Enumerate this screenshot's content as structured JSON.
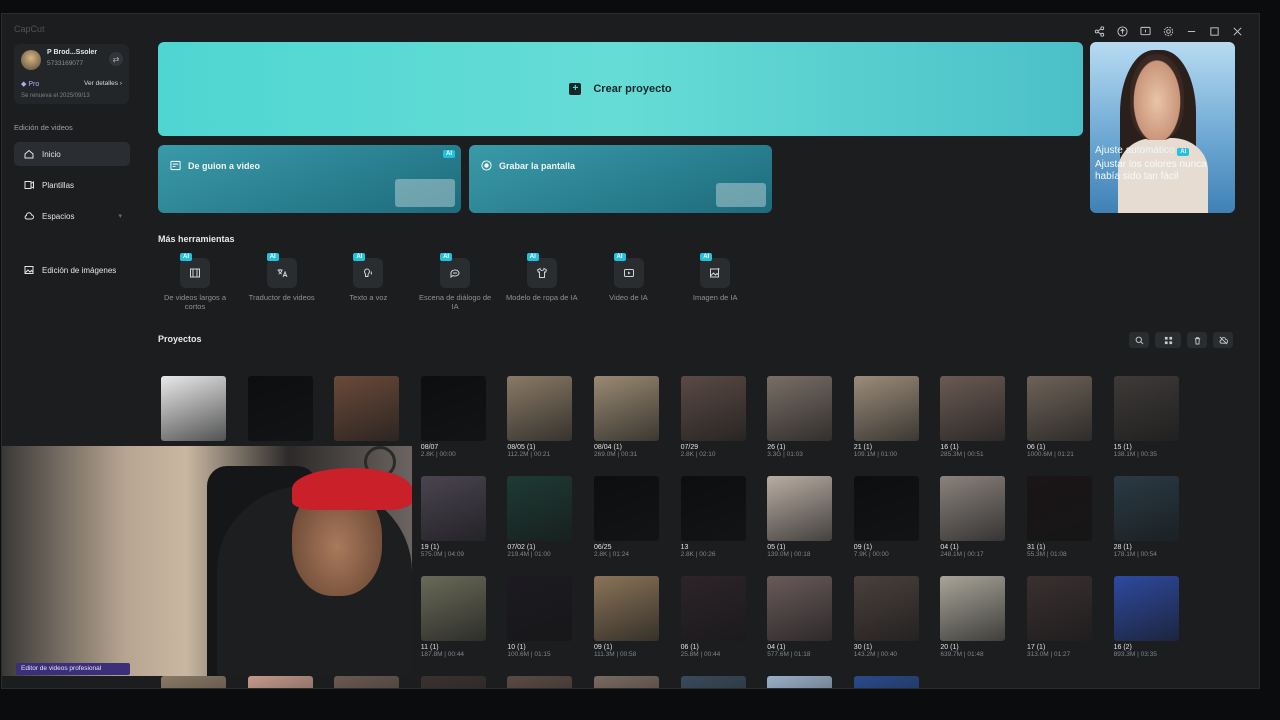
{
  "app": {
    "title": "CapCut"
  },
  "profile": {
    "name": "P Brod...Ssoler",
    "id": "5733169077",
    "plan": "Pro",
    "details": "Ver detalles",
    "renewal": "Se renueva el 2025/09/13"
  },
  "nav": {
    "section": "Edición de videos",
    "items": [
      "Inicio",
      "Plantillas",
      "Espacios",
      "Edición de imágenes"
    ]
  },
  "hero": {
    "create": "Crear proyecto",
    "card1": "De guion a video",
    "card2": "Grabar la pantalla",
    "ai": "AI",
    "promo_title": "Ajuste automático",
    "promo_text": "Ajustar los colores nunca había sido tan fácil"
  },
  "tools": {
    "title": "Más herramientas",
    "items": [
      {
        "label": "De videos largos a cortos",
        "icon": "film-icon"
      },
      {
        "label": "Traductor de videos",
        "icon": "translate-icon"
      },
      {
        "label": "Texto a voz",
        "icon": "voice-icon"
      },
      {
        "label": "Escena de diálogo de IA",
        "icon": "dialogue-icon"
      },
      {
        "label": "Modelo de ropa de IA",
        "icon": "shirt-icon"
      },
      {
        "label": "Video de IA",
        "icon": "video-ai-icon"
      },
      {
        "label": "Imagen de IA",
        "icon": "image-ai-icon"
      }
    ]
  },
  "projects": {
    "title": "Proyectos",
    "row1": [
      {
        "title": "",
        "meta": "",
        "color": "#e9e9e9"
      },
      {
        "title": "",
        "meta": "",
        "color": "#0d0e0f"
      },
      {
        "title": "",
        "meta": "",
        "color": "#6a4a3a"
      },
      {
        "title": "08/07",
        "meta": "2.8K | 00:00",
        "color": "#0d0e0f"
      },
      {
        "title": "08/05 (1)",
        "meta": "112.2M | 00:21",
        "color": "#8a7a66"
      },
      {
        "title": "08/04 (1)",
        "meta": "269.0M | 00:31",
        "color": "#9a8a72"
      },
      {
        "title": "07/29",
        "meta": "2.8K | 02:10",
        "color": "#5a4a44"
      },
      {
        "title": "26 (1)",
        "meta": "3.3G | 01:03",
        "color": "#7a6e66"
      },
      {
        "title": "21 (1)",
        "meta": "109.1M | 01:00",
        "color": "#9c8c7a"
      },
      {
        "title": "16 (1)",
        "meta": "285.3M | 00:51",
        "color": "#6a5a52"
      },
      {
        "title": "06 (1)",
        "meta": "1000.6M | 01:21",
        "color": "#6e6258"
      },
      {
        "title": "15 (1)",
        "meta": "138.1M | 00:35",
        "color": "#3e3a38"
      }
    ],
    "row2": [
      {
        "title": "19 (1)",
        "meta": "575.0M | 04:09",
        "color": "#4a4450"
      },
      {
        "title": "07/02 (1)",
        "meta": "219.4M | 01:00",
        "color": "#1e3a34"
      },
      {
        "title": "06/25",
        "meta": "2.8K | 01:24",
        "color": "#0d0e0f"
      },
      {
        "title": "13",
        "meta": "2.8K | 00:26",
        "color": "#0d0e0f"
      },
      {
        "title": "05 (1)",
        "meta": "139.0M | 00:18",
        "color": "#b9ada2"
      },
      {
        "title": "09 (1)",
        "meta": "7.9K | 00:00",
        "color": "#0d0e0f"
      },
      {
        "title": "04 (1)",
        "meta": "248.1M | 00:17",
        "color": "#8a827c"
      },
      {
        "title": "31 (1)",
        "meta": "55.3M | 01:08",
        "color": "#1a1516"
      },
      {
        "title": "28 (1)",
        "meta": "178.1M | 00:54",
        "color": "#2a3a44"
      }
    ],
    "row3": [
      {
        "title": "11 (1)",
        "meta": "187.8M | 00:44",
        "color": "#6a6a58"
      },
      {
        "title": "10 (1)",
        "meta": "100.6M | 01:15",
        "color": "#1c1a20"
      },
      {
        "title": "09 (1)",
        "meta": "111.3M | 00:58",
        "color": "#8a7458"
      },
      {
        "title": "06 (1)",
        "meta": "25.8M | 00:44",
        "color": "#2c2428"
      },
      {
        "title": "04 (1)",
        "meta": "577.6M | 01:18",
        "color": "#6a5a5a"
      },
      {
        "title": "30 (1)",
        "meta": "143.2M | 00:40",
        "color": "#4a403c"
      },
      {
        "title": "20 (1)",
        "meta": "639.7M | 01:48",
        "color": "#a8a498"
      },
      {
        "title": "17 (1)",
        "meta": "313.0M | 01:27",
        "color": "#3a3030"
      },
      {
        "title": "16 (2)",
        "meta": "893.3M | 03:35",
        "color": "#2e4aa0"
      }
    ],
    "row4_colors": [
      "#8a7a66",
      "#c49a8a",
      "#6a5a52",
      "#3a3230",
      "#5a4a44",
      "#7a6a60",
      "#3a4a5a",
      "#9ab0c8",
      "#2a4a8a"
    ]
  },
  "overlay": {
    "caption": "Editor de videos profesional"
  },
  "colors": {
    "accent": "#4fd6d2",
    "ai_badge": "#23c1e0",
    "pro": "#b7a4ff"
  }
}
